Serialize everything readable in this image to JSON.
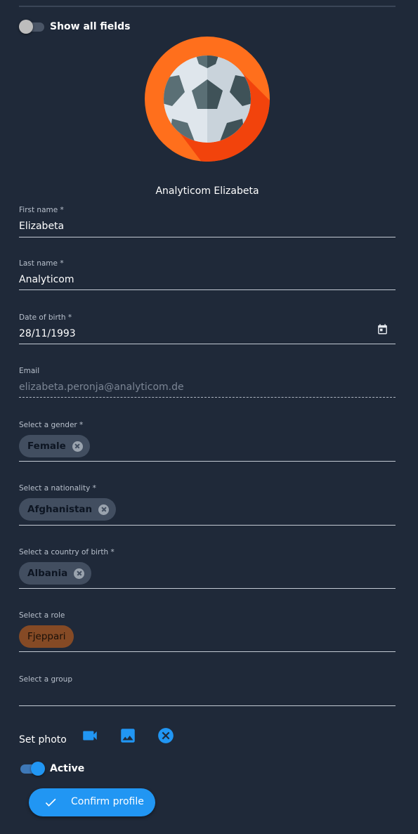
{
  "header": {
    "show_all_fields_label": "Show all fields",
    "show_all_fields_on": false
  },
  "profile": {
    "avatar_icon": "soccer-ball-icon",
    "display_name": "Analyticom Elizabeta"
  },
  "fields": {
    "first_name": {
      "label": "First name *",
      "value": "Elizabeta"
    },
    "last_name": {
      "label": "Last name *",
      "value": "Analyticom"
    },
    "date_of_birth": {
      "label": "Date of birth *",
      "value": "28/11/1993",
      "icon": "calendar-icon"
    },
    "email": {
      "label": "Email",
      "value": "elizabeta.peronja@analyticom.de",
      "disabled": true
    },
    "gender": {
      "label": "Select a gender *",
      "chip": "Female"
    },
    "nationality": {
      "label": "Select a nationality *",
      "chip": "Afghanistan"
    },
    "country_of_birth": {
      "label": "Select a country of birth *",
      "chip": "Albania"
    },
    "role": {
      "label": "Select a role",
      "chip": "Fjeppari"
    },
    "group": {
      "label": "Select a group",
      "value": ""
    }
  },
  "photo": {
    "label": "Set photo",
    "icons": [
      "video-camera-icon",
      "image-icon",
      "clear-icon"
    ]
  },
  "status": {
    "active_label": "Active",
    "active_on": true
  },
  "actions": {
    "confirm_label": "Confirm profile",
    "confirm_icon": "check-icon"
  },
  "colors": {
    "background": "#1f2939",
    "accent": "#2196f3",
    "chip": "#424e60",
    "role_chip": "#854a25",
    "avatar_orange": "#ff6f1c"
  }
}
